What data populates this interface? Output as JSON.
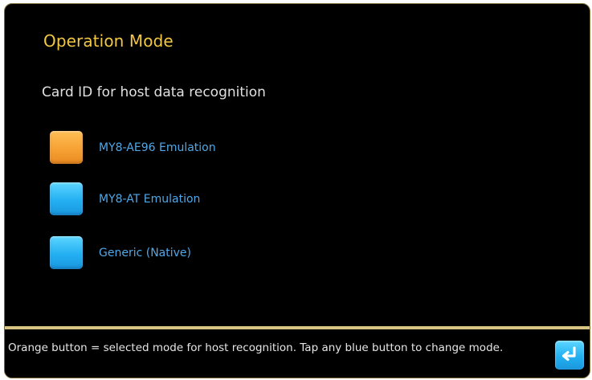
{
  "screen": {
    "title": "Operation Mode",
    "subtitle": "Card ID for host data recognition"
  },
  "modes": [
    {
      "label": "MY8-AE96 Emulation",
      "state": "selected",
      "color": "#f7a234"
    },
    {
      "label": "MY8-AT Emulation",
      "state": "available",
      "color": "#23b0f2"
    },
    {
      "label": "Generic (Native)",
      "state": "available",
      "color": "#23b0f2"
    }
  ],
  "help": {
    "text": "Orange button = selected mode for host recognition. Tap any blue button to change mode."
  },
  "enter_button": {
    "icon": "enter-return-icon"
  },
  "colors": {
    "title": "#f2c744",
    "label": "#4fa8e8",
    "divider": "#d8c482",
    "background": "#000000"
  }
}
